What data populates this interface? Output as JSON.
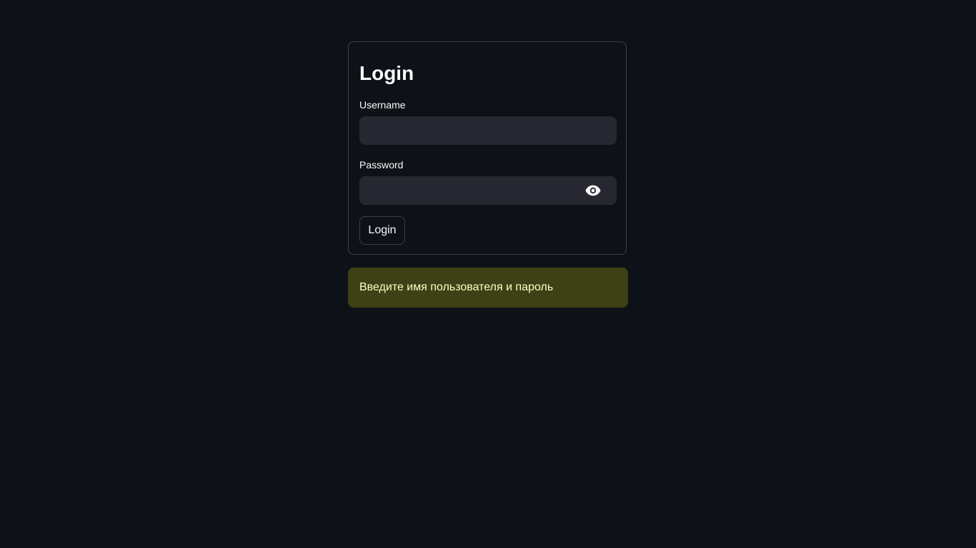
{
  "login_form": {
    "title": "Login",
    "username": {
      "label": "Username",
      "value": ""
    },
    "password": {
      "label": "Password",
      "value": ""
    },
    "submit_label": "Login"
  },
  "alert": {
    "text": "Введите имя пользователя и пароль"
  },
  "colors": {
    "background": "#0e1117",
    "input_background": "#262730",
    "text": "#fafafa",
    "alert_background": "#3d3d1c",
    "alert_text": "#ffffc2"
  },
  "icons": {
    "password_toggle": "eye-icon"
  }
}
